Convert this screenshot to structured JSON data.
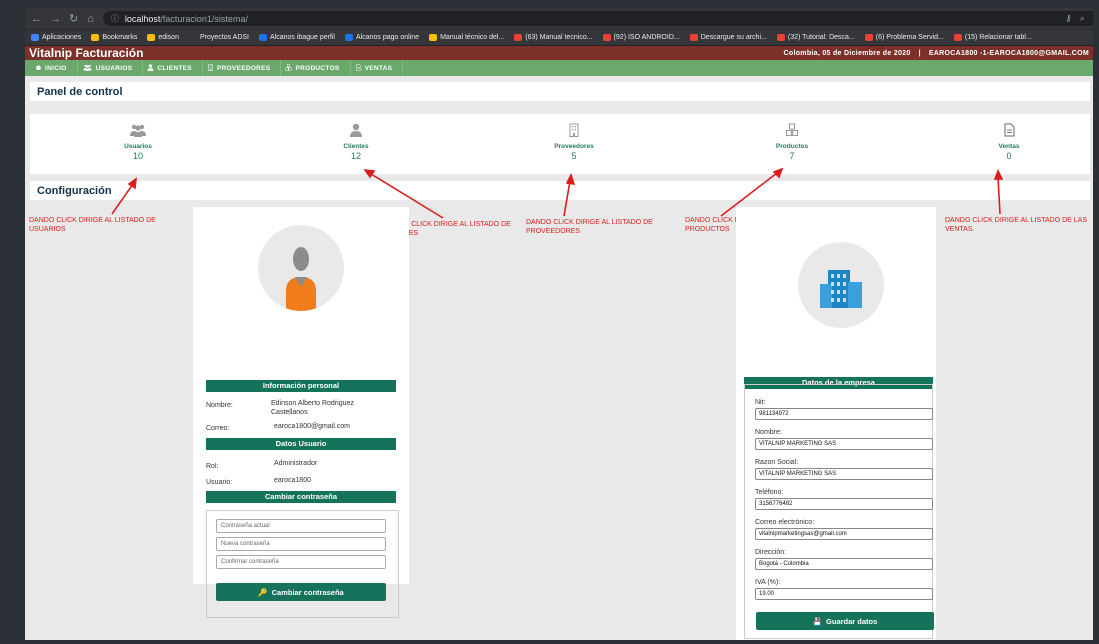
{
  "browser": {
    "url_host": "localhost",
    "url_path": "/facturacion1/sistema/",
    "bookmarks": [
      {
        "label": "Aplicaciones",
        "color": "#4285f4"
      },
      {
        "label": "Bookmarks",
        "color": "#fbbc04"
      },
      {
        "label": "edison",
        "color": "#fbbc04"
      },
      {
        "label": "Proyectos ADSI",
        "color": "#35363a"
      },
      {
        "label": "Alcanos ibague perfil",
        "color": "#1a73e8"
      },
      {
        "label": "Alcanos pago online",
        "color": "#1a73e8"
      },
      {
        "label": "Manual técnico del...",
        "color": "#fbbc04"
      },
      {
        "label": "(63) Manual tecnico...",
        "color": "#ea4335"
      },
      {
        "label": "(92) ISO ANDROID...",
        "color": "#ea4335"
      },
      {
        "label": "Descargue su archi...",
        "color": "#ea4335"
      },
      {
        "label": "(32) Tutorial: Desca...",
        "color": "#ea4335"
      },
      {
        "label": "(6) Problema Servid...",
        "color": "#ea4335"
      },
      {
        "label": "(15) Relacionar tabl...",
        "color": "#ea4335"
      }
    ]
  },
  "app": {
    "title": "Vitalnip Facturación",
    "date": "Colombia, 05 de Diciembre de 2020",
    "separator": "|",
    "user": "EAROCA1800 -1-EAROCA1800@GMAIL.COM",
    "menu": [
      {
        "label": "INICIO",
        "icon": "home-icon"
      },
      {
        "label": "USUARIOS",
        "icon": "users-icon"
      },
      {
        "label": "CLIENTES",
        "icon": "user-icon"
      },
      {
        "label": "PROVEEDORES",
        "icon": "building-icon"
      },
      {
        "label": "PRODUCTOS",
        "icon": "cubes-icon"
      },
      {
        "label": "VENTAS",
        "icon": "file-icon"
      }
    ]
  },
  "panel": {
    "title": "Panel de control",
    "stats": [
      {
        "label": "Usuarios",
        "count": "10",
        "icon": "users-icon"
      },
      {
        "label": "Clientes",
        "count": "12",
        "icon": "user-icon"
      },
      {
        "label": "Proveedores",
        "count": "5",
        "icon": "building-icon"
      },
      {
        "label": "Productos",
        "count": "7",
        "icon": "cubes-icon"
      },
      {
        "label": "Ventas",
        "count": "0",
        "icon": "file-icon"
      }
    ]
  },
  "config": {
    "title": "Configuración"
  },
  "annotations": [
    "DANDO CLICK DIRIGE AL LISTADO DE USUARIOS",
    "DANDO CLICK DIRIGE AL LISTADO DE CLIENTES",
    "DANDO CLICK DIRIGE AL LISTADO DE PROVEEDORES",
    "DANDO CLICK DIRIGE AL LISTADO DE PRODUCTOS",
    "DANDO CLICK DIRIGE AL LISTADO DE LAS VENTAS."
  ],
  "annotation_color": "#d91e1e",
  "profile": {
    "personal_title": "Información personal",
    "name_label": "Nombre:",
    "name_value": "Edinson Alberto Rodriguez Castellanos",
    "email_label": "Correo:",
    "email_value": "earoca1800@gmail.com",
    "user_data_title": "Datos Usuario",
    "role_label": "Rol:",
    "role_value": "Administrador",
    "user_label": "Usuario:",
    "user_value": "earoca1800",
    "change_pwd_title": "Cambiar contraseña",
    "current_pwd_placeholder": "Contraseña actual",
    "new_pwd_placeholder": "Nueva contraseña",
    "confirm_pwd_placeholder": "Confirmar contraseña",
    "change_pwd_button": "Cambiar contraseña"
  },
  "company": {
    "title": "Datos de la empresa",
    "fields": [
      {
        "label": "Nit:",
        "value": "981134972"
      },
      {
        "label": "Nombre:",
        "value": "VITALNIP MARKETING SAS"
      },
      {
        "label": "Razon Social:",
        "value": "VITALNIP MARKETING SAS"
      },
      {
        "label": "Teléfono:",
        "value": "3156776482"
      },
      {
        "label": "Correo electrónico:",
        "value": "vitalnipmarketingsas@gmail.com"
      },
      {
        "label": "Dirección:",
        "value": "Bogotá - Colombia"
      },
      {
        "label": "IVA (%):",
        "value": "19.00"
      }
    ],
    "save_button": "Guardar datos"
  },
  "colors": {
    "header": "#7b312a",
    "menu": "#6aa96b",
    "accent": "#14735a"
  }
}
